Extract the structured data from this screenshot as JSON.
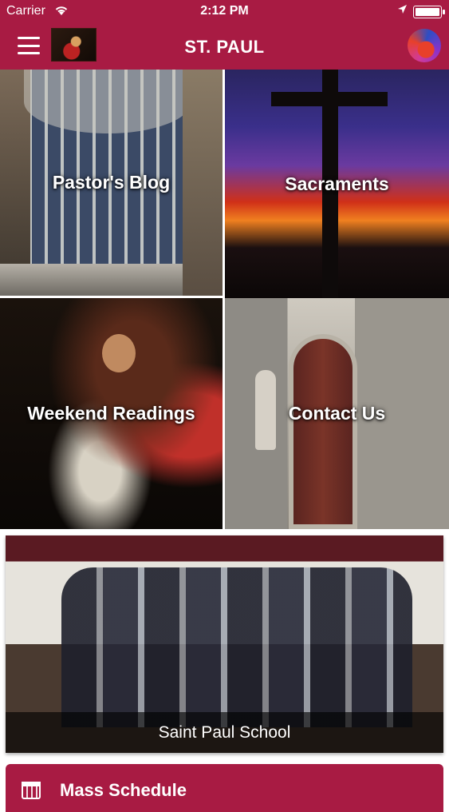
{
  "status_bar": {
    "carrier": "Carrier",
    "time": "2:12 PM"
  },
  "header": {
    "title": "ST. PAUL"
  },
  "tiles": [
    {
      "label": "Pastor's Blog"
    },
    {
      "label": "Sacraments"
    },
    {
      "label": "Weekend Readings"
    },
    {
      "label": "Contact Us"
    }
  ],
  "banner": {
    "caption": "Saint Paul School"
  },
  "mass_schedule": {
    "label": "Mass Schedule"
  },
  "colors": {
    "brand": "#a81b43"
  }
}
